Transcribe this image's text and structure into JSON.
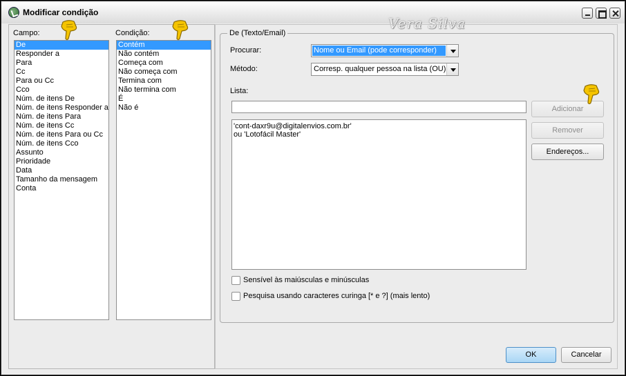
{
  "window": {
    "title": "Modificar condição",
    "watermark": "Vera Silva"
  },
  "fields": {
    "label": "Campo:",
    "items": [
      "De",
      "Responder a",
      "Para",
      "Cc",
      "Para ou Cc",
      "Cco",
      "Núm. de itens De",
      "Núm. de itens Responder a",
      "Núm. de itens Para",
      "Núm. de itens Cc",
      "Núm. de itens Para ou Cc",
      "Núm. de itens Cco",
      "Assunto",
      "Prioridade",
      "Data",
      "Tamanho da mensagem",
      "Conta"
    ],
    "selected": "De"
  },
  "conditions": {
    "label": "Condição:",
    "items": [
      "Contém",
      "Não contém",
      "Começa com",
      "Não começa com",
      "Termina com",
      "Não termina com",
      "É",
      "Não é"
    ],
    "selected": "Contém"
  },
  "group": {
    "legend": "De (Texto/Email)",
    "search_label": "Procurar:",
    "search_value": "Nome ou Email (pode corresponder)",
    "method_label": "Método:",
    "method_value": "Corresp. qualquer pessoa na lista (OU)",
    "list_label": "Lista:",
    "list_input_value": "",
    "list_lines": [
      "'cont-daxr9u@digitalenvios.com.br'",
      "ou 'Lotofácil Master'"
    ],
    "add_button": "Adicionar",
    "remove_button": "Remover",
    "addresses_button": "Endereços...",
    "case_sensitive_label": "Sensível às maiúsculas e minúsculas",
    "case_sensitive_checked": false,
    "wildcard_label": "Pesquisa usando caracteres curinga [* e ?] (mais lento)",
    "wildcard_checked": false
  },
  "footer": {
    "ok_button": "OK",
    "cancel_button": "Cancelar"
  },
  "colors": {
    "selection": "#3399ff",
    "pointer": "#f5c400"
  }
}
